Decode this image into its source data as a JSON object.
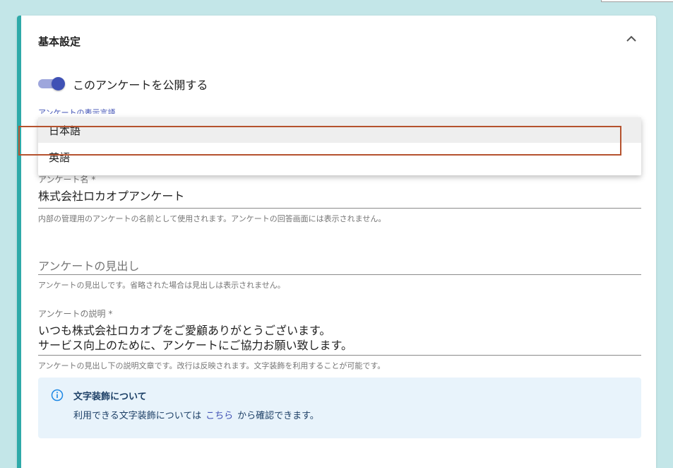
{
  "card": {
    "title": "基本設定"
  },
  "publish_toggle": {
    "label": "このアンケートを公開する",
    "checked": true
  },
  "language": {
    "label": "アンケートの表示言語",
    "options": [
      "日本語",
      "英語"
    ],
    "highlighted_option": "英語"
  },
  "survey_name": {
    "label": "アンケート名 *",
    "value": "株式会社ロカオプアンケート",
    "helper": "内部の管理用のアンケートの名前として使用されます。アンケートの回答画面には表示されません。"
  },
  "survey_heading": {
    "placeholder": "アンケートの見出し",
    "helper": "アンケートの見出しです。省略された場合は見出しは表示されません。"
  },
  "survey_description": {
    "label": "アンケートの説明 *",
    "line1": "いつも株式会社ロカオプをご愛顧ありがとうございます。",
    "line2": "サービス向上のために、アンケートにご協力お願い致します。",
    "helper": "アンケートの見出し下の説明文章です。改行は反映されます。文字装飾を利用することが可能です。"
  },
  "info": {
    "title": "文字装飾について",
    "text_before": "利用できる文字装飾については",
    "link": "こちら",
    "text_after": "から確認できます。"
  },
  "colors": {
    "accent": "#2eaaa9",
    "primary": "#3f51b5",
    "highlight_border": "#b5522e",
    "info_bg": "#e8f3fb"
  }
}
